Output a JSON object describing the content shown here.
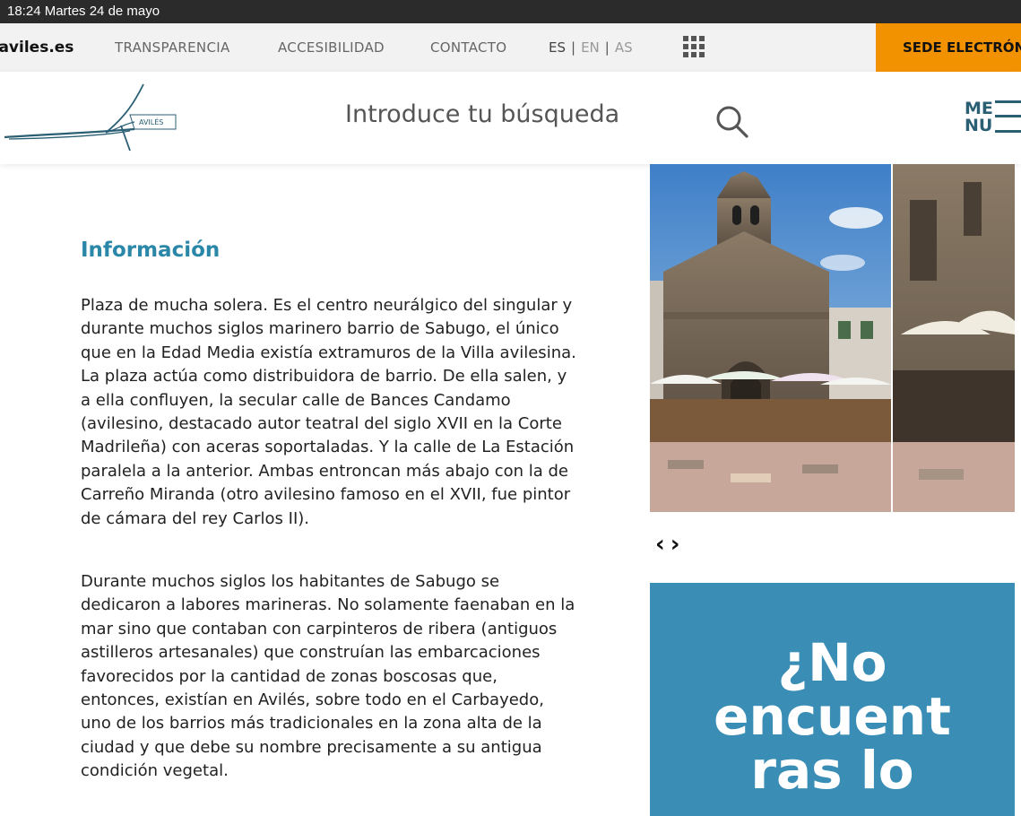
{
  "status_bar": {
    "time_date": "18:24  Martes 24 de mayo"
  },
  "topnav": {
    "site": ".aviles.es",
    "links": [
      "TRANSPARENCIA",
      "ACCESIBILIDAD",
      "CONTACTO"
    ],
    "lang": {
      "es": "ES",
      "en": "EN",
      "as": "AS",
      "sep": "|"
    },
    "apps_icon": "grid-icon",
    "sede_label": "SEDE ELECTRÓNICA"
  },
  "header": {
    "logo_text": "AVILÉS",
    "search_placeholder": "Introduce tu búsqueda",
    "search_icon": "search-icon",
    "menu_label_1": "ME",
    "menu_label_2": "NU"
  },
  "content": {
    "title": "Información",
    "paragraphs": [
      "Plaza de mucha solera. Es el centro neurálgico del singular y durante muchos siglos marinero barrio de Sabugo, el único que en la Edad Media existía extramuros de la Villa avilesina. La plaza actúa como distribuidora de barrio. De ella salen, y a ella confluyen, la secular calle de Bances Candamo (avilesino, destacado autor teatral del siglo XVII en la Corte Madrileña) con aceras soportaladas. Y la calle de La Estación paralela a la anterior. Ambas entroncan más abajo con la de Carreño Miranda (otro avilesino famoso en el XVII, fue pintor de cámara del rey Carlos II).",
      "Durante muchos siglos los habitantes de Sabugo se dedicaron a labores marineras. No solamente faenaban en la mar sino que contaban con carpinteros de ribera (antiguos astilleros artesanales) que construían las embarcaciones favorecidos por la cantidad de zonas boscosas que, entonces, existían en Avilés, sobre todo en el Carbayedo, uno de los barrios más tradicionales en la zona alta de la ciudad y que debe su nombre precisamente a su antigua condición vegetal."
    ]
  },
  "gallery": {
    "prev": "‹",
    "next": "›"
  },
  "cta": {
    "line1": "¿No",
    "line2": "encuent",
    "line3": "ras lo"
  }
}
